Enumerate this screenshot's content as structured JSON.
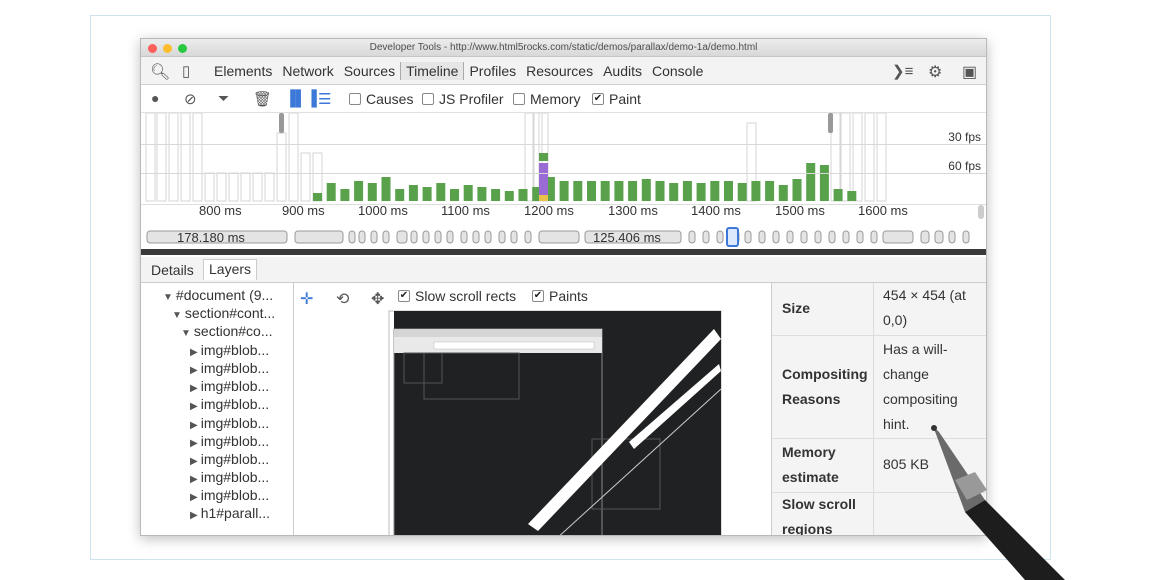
{
  "window": {
    "title": "Developer Tools - http://www.html5rocks.com/static/demos/parallax/demo-1a/demo.html"
  },
  "tabs": [
    "Elements",
    "Network",
    "Sources",
    "Timeline",
    "Profiles",
    "Resources",
    "Audits",
    "Console"
  ],
  "active_tab": "Timeline",
  "toolbar": {
    "causes_label": "Causes",
    "js_profiler_label": "JS Profiler",
    "memory_label": "Memory",
    "paint_label": "Paint",
    "causes_checked": false,
    "js_profiler_checked": false,
    "memory_checked": false,
    "paint_checked": true
  },
  "overview": {
    "fps30_label": "30 fps",
    "fps60_label": "60 fps",
    "ruler_ticks": [
      "800 ms",
      "900 ms",
      "1000 ms",
      "1100 ms",
      "1200 ms",
      "1300 ms",
      "1400 ms",
      "1500 ms",
      "1600 ms"
    ],
    "frame_time_1": "178.180 ms",
    "frame_time_2": "125.406 ms",
    "bar_color": "#5aa14b",
    "purple_color": "#9b6bd5",
    "yellow_color": "#e8c04a"
  },
  "subtabs": {
    "details": "Details",
    "layers": "Layers",
    "active": "Layers"
  },
  "tree": [
    "#document (9...",
    "section#cont...",
    "section#co...",
    "img#blob...",
    "img#blob...",
    "img#blob...",
    "img#blob...",
    "img#blob...",
    "img#blob...",
    "img#blob...",
    "img#blob...",
    "img#blob...",
    "h1#parall..."
  ],
  "layers_toolbar": {
    "slow_scroll_label": "Slow scroll rects",
    "paints_label": "Paints",
    "slow_scroll_checked": true,
    "paints_checked": true
  },
  "props": {
    "size_key": "Size",
    "size_val": "454 × 454 (at 0,0)",
    "reasons_key": "Compositing Reasons",
    "reasons_val": "Has a will-change compositing hint.",
    "memory_key": "Memory estimate",
    "memory_val": "805 KB",
    "slow_key": "Slow scroll regions"
  }
}
